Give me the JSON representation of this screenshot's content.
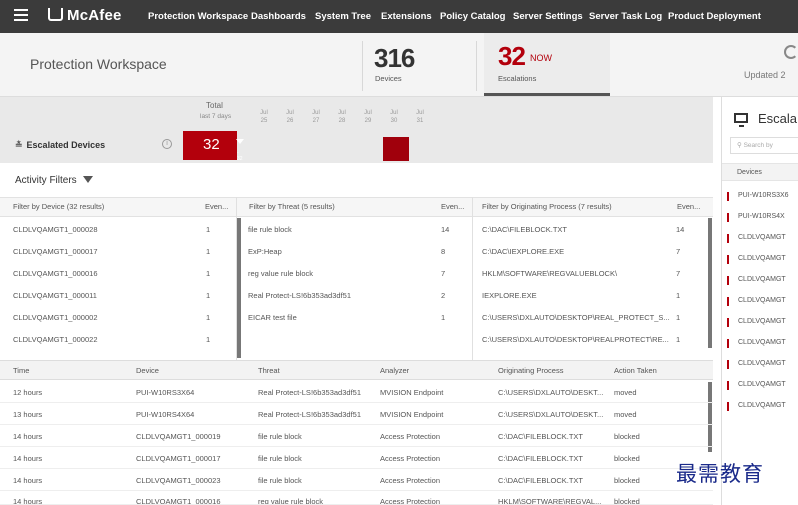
{
  "nav": {
    "brand": "McAfee",
    "items": [
      "Protection Workspace",
      "Dashboards",
      "System Tree",
      "Extensions",
      "Policy Catalog",
      "Server Settings",
      "Server Task Log",
      "Product Deployment"
    ]
  },
  "header": {
    "title": "Protection Workspace",
    "devices_count": "316",
    "devices_label": "Devices",
    "escalations_count": "32",
    "escalations_now": "NOW",
    "escalations_label": "Escalations",
    "updated": "Updated 2"
  },
  "timeline": {
    "total_label": "Total",
    "period_label": "last 7 days",
    "days": [
      {
        "mon": "Jul",
        "day": "25"
      },
      {
        "mon": "Jul",
        "day": "26"
      },
      {
        "mon": "Jul",
        "day": "27"
      },
      {
        "mon": "Jul",
        "day": "28"
      },
      {
        "mon": "Jul",
        "day": "29"
      },
      {
        "mon": "Jul",
        "day": "30"
      },
      {
        "mon": "Jul",
        "day": "31"
      }
    ],
    "section_label": "Escalated Devices",
    "total_count": "32",
    "total_delta": "- 32"
  },
  "filters": {
    "title": "Activity Filters",
    "by_device": {
      "header": "Filter by Device (32 results)",
      "count_header": "Even...",
      "rows": [
        {
          "name": "CLDLVQAMGT1_000028",
          "count": "1"
        },
        {
          "name": "CLDLVQAMGT1_000017",
          "count": "1"
        },
        {
          "name": "CLDLVQAMGT1_000016",
          "count": "1"
        },
        {
          "name": "CLDLVQAMGT1_000011",
          "count": "1"
        },
        {
          "name": "CLDLVQAMGT1_000002",
          "count": "1"
        },
        {
          "name": "CLDLVQAMGT1_000022",
          "count": "1"
        }
      ]
    },
    "by_threat": {
      "header": "Filter by Threat (5 results)",
      "count_header": "Even...",
      "rows": [
        {
          "name": "file rule block",
          "count": "14"
        },
        {
          "name": "ExP:Heap",
          "count": "8"
        },
        {
          "name": "reg value rule block",
          "count": "7"
        },
        {
          "name": "Real Protect-LS!6b353ad3df51",
          "count": "2"
        },
        {
          "name": "EICAR test file",
          "count": "1"
        }
      ]
    },
    "by_process": {
      "header": "Filter by Originating Process (7 results)",
      "count_header": "Even...",
      "rows": [
        {
          "name": "C:\\DAC\\FILEBLOCK.TXT",
          "count": "14"
        },
        {
          "name": "C:\\DAC\\IEXPLORE.EXE",
          "count": "7"
        },
        {
          "name": "HKLM\\SOFTWARE\\REGVALUEBLOCK\\",
          "count": "7"
        },
        {
          "name": "IEXPLORE.EXE",
          "count": "1"
        },
        {
          "name": "C:\\USERS\\DXLAUTO\\DESKTOP\\REAL_PROTECT_S...",
          "count": "1"
        },
        {
          "name": "C:\\USERS\\DXLAUTO\\DESKTOP\\REALPROTECT\\RE...",
          "count": "1"
        }
      ]
    }
  },
  "events": {
    "columns": [
      "Time",
      "Device",
      "Threat",
      "Analyzer",
      "Originating Process",
      "Action Taken"
    ],
    "rows": [
      [
        "12 hours",
        "PUI-W10RS3X64",
        "Real Protect-LS!6b353ad3df51",
        "MVISION Endpoint",
        "C:\\USERS\\DXLAUTO\\DESKT...",
        "moved"
      ],
      [
        "13 hours",
        "PUI-W10RS4X64",
        "Real Protect-LS!6b353ad3df51",
        "MVISION Endpoint",
        "C:\\USERS\\DXLAUTO\\DESKT...",
        "moved"
      ],
      [
        "14 hours",
        "CLDLVQAMGT1_000019",
        "file rule block",
        "Access Protection",
        "C:\\DAC\\FILEBLOCK.TXT",
        "blocked"
      ],
      [
        "14 hours",
        "CLDLVQAMGT1_000017",
        "file rule block",
        "Access Protection",
        "C:\\DAC\\FILEBLOCK.TXT",
        "blocked"
      ],
      [
        "14 hours",
        "CLDLVQAMGT1_000023",
        "file rule block",
        "Access Protection",
        "C:\\DAC\\FILEBLOCK.TXT",
        "blocked"
      ],
      [
        "14 hours",
        "CLDLVQAMGT1_000016",
        "reg value rule block",
        "Access Protection",
        "HKLM\\SOFTWARE\\REGVAL...",
        "blocked"
      ]
    ]
  },
  "right_panel": {
    "title": "Escala",
    "search_placeholder": "Search by",
    "devices_header": "Devices",
    "items": [
      "PUI-W10RS3X6",
      "PUI-W10RS4X",
      "CLDLVQAMGT",
      "CLDLVQAMGT",
      "CLDLVQAMGT",
      "CLDLVQAMGT",
      "CLDLVQAMGT",
      "CLDLVQAMGT",
      "CLDLVQAMGT",
      "CLDLVQAMGT",
      "CLDLVQAMGT"
    ]
  },
  "watermark": "最需教育",
  "colors": {
    "accent_red": "#b3000c",
    "nav_bg": "#3b3b3b"
  },
  "icons": [
    "menu-icon",
    "mcafee-logo-icon",
    "refresh-icon",
    "chevron-down-icon",
    "info-icon",
    "filter-icon",
    "monitor-icon",
    "search-icon"
  ]
}
